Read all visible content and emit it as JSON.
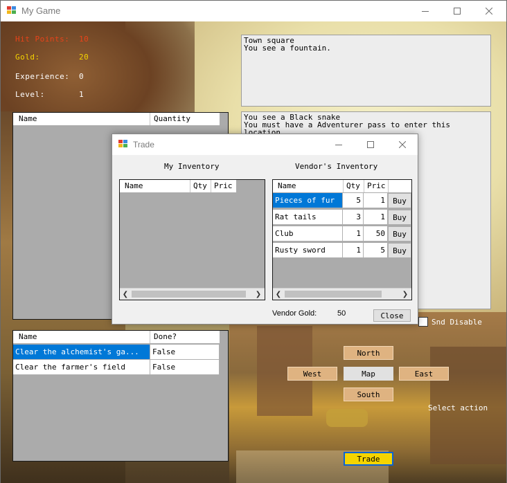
{
  "window": {
    "title": "My Game",
    "minimize_icon": "minimize-icon",
    "maximize_icon": "maximize-icon",
    "close_icon": "close-icon"
  },
  "stats": [
    {
      "label": "Hit Points:",
      "value": "10",
      "color": "#e8431a"
    },
    {
      "label": "Gold:",
      "value": "20",
      "color": "#f5d400"
    },
    {
      "label": "Experience:",
      "value": "0",
      "color": "#ffffff"
    },
    {
      "label": "Level:",
      "value": "1",
      "color": "#ffffff"
    }
  ],
  "inventory_grid": {
    "columns": [
      "Name",
      "Quantity"
    ]
  },
  "location_text": "Town square\nYou see a fountain.",
  "message_text": "You see a Black snake\nYou must have a Adventurer pass to enter this\nlocation",
  "quests": {
    "columns": [
      "Name",
      "Done?"
    ],
    "rows": [
      {
        "name": "Clear the alchemist's ga...",
        "done": "False",
        "selected": true
      },
      {
        "name": "Clear the farmer's field",
        "done": "False",
        "selected": false
      }
    ]
  },
  "nav": {
    "north": "North",
    "west": "West",
    "map": "Map",
    "east": "East",
    "south": "South"
  },
  "snd_disable": "Snd Disable",
  "select_action": "Select action",
  "trade_button": "Trade",
  "trade_dialog": {
    "title": "Trade",
    "my_inventory_label": "My Inventory",
    "vendor_inventory_label": "Vendor's Inventory",
    "my_columns": [
      "Name",
      "Qty",
      "Pric"
    ],
    "vendor_columns": [
      "Name",
      "Qty",
      "Pric"
    ],
    "vendor_items": [
      {
        "name": "Pieces of fur",
        "qty": "5",
        "price": "1",
        "action": "Buy",
        "selected": true
      },
      {
        "name": "Rat tails",
        "qty": "3",
        "price": "1",
        "action": "Buy",
        "selected": false
      },
      {
        "name": "Club",
        "qty": "1",
        "price": "50",
        "action": "Buy",
        "selected": false
      },
      {
        "name": "Rusty sword",
        "qty": "1",
        "price": "5",
        "action": "Buy",
        "selected": false
      }
    ],
    "vendor_gold_label": "Vendor Gold:",
    "vendor_gold_value": "50",
    "close_label": "Close"
  },
  "colors": {
    "selection": "#0078d7",
    "nav_button": "#dfb381",
    "trade_button": "#f5d400",
    "trade_button_border": "#0a64d6"
  }
}
